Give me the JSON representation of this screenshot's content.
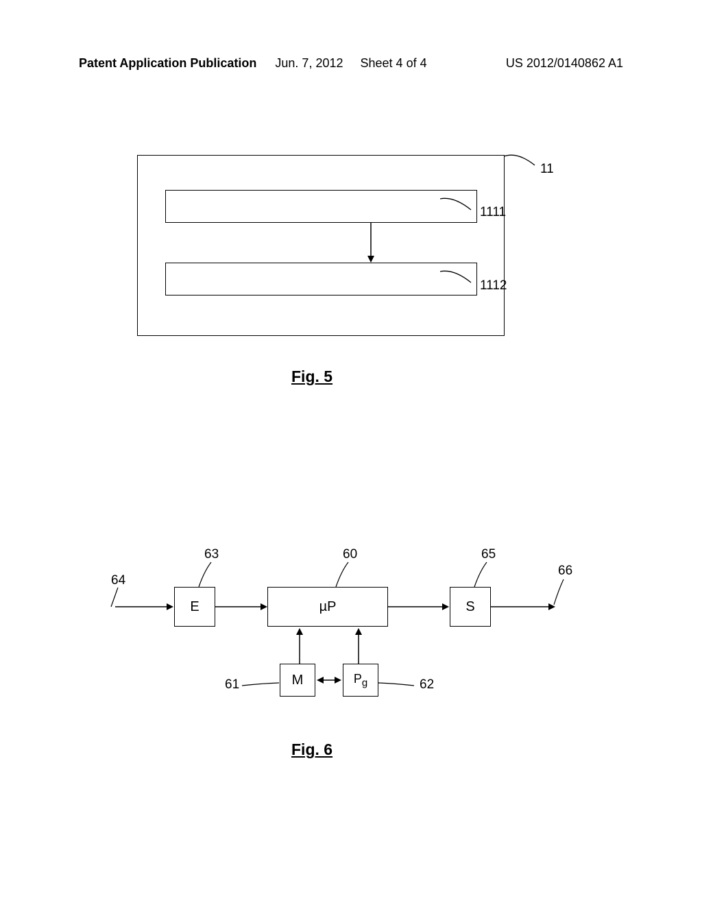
{
  "header": {
    "left": "Patent Application Publication",
    "date": "Jun. 7, 2012",
    "sheet": "Sheet 4 of 4",
    "pubno": "US 2012/0140862 A1"
  },
  "fig5": {
    "caption": "Fig. 5",
    "labels": {
      "outer": "11",
      "inner1": "1111",
      "inner2": "1112"
    }
  },
  "fig6": {
    "caption": "Fig. 6",
    "boxes": {
      "e": "E",
      "up": "µP",
      "s": "S",
      "m": "M",
      "pg": "Pg"
    },
    "labels": {
      "l64": "64",
      "l63": "63",
      "l60": "60",
      "l65": "65",
      "l66": "66",
      "l61": "61",
      "l62": "62"
    }
  }
}
